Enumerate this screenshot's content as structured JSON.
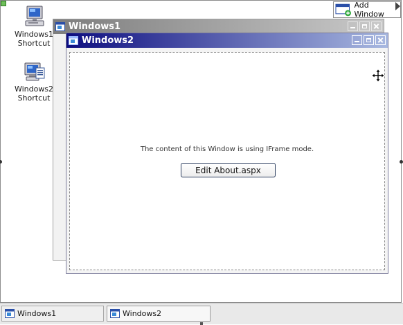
{
  "desktop": {
    "icons": [
      {
        "label_line1": "Windows1",
        "label_line2": "Shortcut",
        "icon": "computer-icon"
      },
      {
        "label_line1": "Windows2",
        "label_line2": "Shortcut",
        "icon": "computer-doc-icon"
      }
    ],
    "add_window_label": "Add Window"
  },
  "windows": [
    {
      "title": "Windows1",
      "state": "inactive"
    },
    {
      "title": "Windows2",
      "state": "active",
      "content_text": "The content of this Window is using IFrame mode.",
      "button_label": "Edit About.aspx"
    }
  ],
  "taskbar": {
    "items": [
      {
        "label": "Windows1"
      },
      {
        "label": "Windows2",
        "active": true
      }
    ]
  },
  "colors": {
    "active_title_start": "#0e0e80",
    "active_title_end": "#a8b8e0",
    "inactive_title_start": "#7d7d7d",
    "inactive_title_end": "#c9c9c9"
  }
}
